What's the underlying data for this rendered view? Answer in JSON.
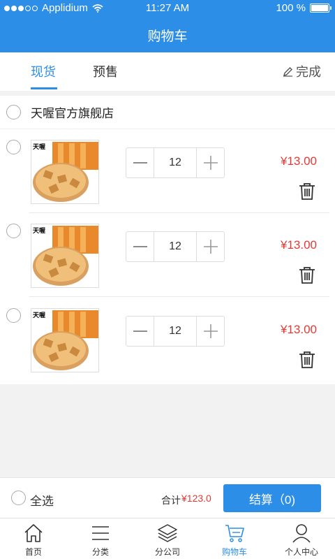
{
  "status": {
    "carrier": "Applidium",
    "time": "11:27 AM",
    "battery": "100 %"
  },
  "header": {
    "title": "购物车"
  },
  "tabs": [
    {
      "label": "现货"
    },
    {
      "label": "预售"
    }
  ],
  "done_label": "完成",
  "shop": {
    "name": "天喔官方旗舰店"
  },
  "items": [
    {
      "quantity": "12",
      "price": "¥13.00"
    },
    {
      "quantity": "12",
      "price": "¥13.00"
    },
    {
      "quantity": "12",
      "price": "¥13.00"
    }
  ],
  "footer": {
    "select_all": "全选",
    "total_label": "合计",
    "total_amount": "¥123.0",
    "checkout": "结算（0)"
  },
  "tabbar": [
    {
      "label": "首页",
      "icon": "home-icon"
    },
    {
      "label": "分类",
      "icon": "list-icon"
    },
    {
      "label": "分公司",
      "icon": "layers-icon"
    },
    {
      "label": "购物车",
      "icon": "cart-icon"
    },
    {
      "label": "个人中心",
      "icon": "user-icon"
    }
  ],
  "colors": {
    "primary": "#2d8ee8",
    "price": "#e53935"
  }
}
